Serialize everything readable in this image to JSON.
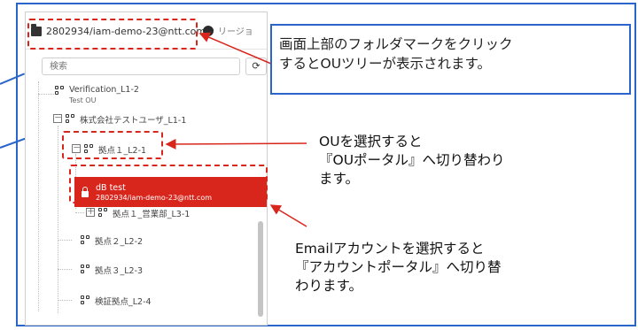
{
  "toolbar": {
    "account_selector": "2802934/iam-demo-23@ntt.com",
    "region_label": "リージョ"
  },
  "search": {
    "placeholder": "検索",
    "refresh_icon": "refresh-icon"
  },
  "tree": {
    "verification_name": "Verification_L1-2",
    "verification_sub": "Test OU",
    "company_name": "株式会社テストユーザ_L1-1",
    "base1_name": "拠点１_L2-1",
    "selected_account_name": "dB test",
    "selected_account_email": "2802934/iam-demo-23@ntt.com",
    "sales_name": "拠点１_営業部_L3-1",
    "base2_name": "拠点２_L2-2",
    "base3_name": "拠点３_L2-3",
    "verify_base_name": "検証拠点_L2-4",
    "expand_symbol": "－",
    "collapsed_symbol": "＋"
  },
  "annotations": {
    "folder_callout_line1": "画面上部のフォルダマークをクリック",
    "folder_callout_line2": "するとOUツリーが表示されます。",
    "ou_callout_line1": "OUを選択すると",
    "ou_callout_line2": "『OUポータル』へ切り替わり",
    "ou_callout_line3": "ます。",
    "email_callout_line1": "Emailアカウントを選択すると",
    "email_callout_line2": "『アカウントポータル』へ切り替",
    "email_callout_line3": "わります。"
  },
  "colors": {
    "frame_blue": "#2a66c9",
    "highlight_red": "#d9261c"
  }
}
